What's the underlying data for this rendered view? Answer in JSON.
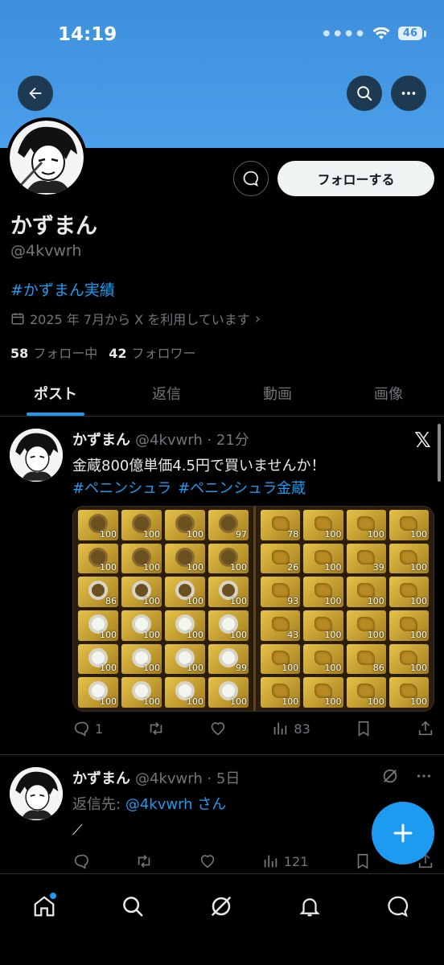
{
  "status_bar": {
    "time": "14:19",
    "battery": "46"
  },
  "profile": {
    "name": "かずまん",
    "handle": "@4kvwrh",
    "bio_hashtag": "#かずまん実績",
    "joined": "2025 年 7月から X を利用しています",
    "following_count": "58",
    "following_label": "フォロー中",
    "followers_count": "42",
    "followers_label": "フォロワー",
    "follow_button": "フォローする"
  },
  "tabs": [
    {
      "label": "ポスト",
      "active": true
    },
    {
      "label": "返信",
      "active": false
    },
    {
      "label": "動画",
      "active": false
    },
    {
      "label": "画像",
      "active": false
    }
  ],
  "posts": [
    {
      "name": "かずまん",
      "meta": "@4kvwrh · 21分",
      "text": "金蔵800億単価4.5円で買いませんか！",
      "tags": [
        "#ペニンシュラ",
        "#ペニンシュラ金蔵"
      ],
      "replies": "1",
      "views": "83",
      "media_left_quantities": [
        "100",
        "100",
        "100",
        "97",
        "100",
        "100",
        "100",
        "100",
        "86",
        "100",
        "100",
        "100",
        "100",
        "100",
        "100",
        "100",
        "100",
        "100",
        "100",
        "99",
        "100",
        "100",
        "100",
        "100"
      ],
      "media_right_quantities": [
        "78",
        "100",
        "100",
        "100",
        "26",
        "100",
        "39",
        "100",
        "93",
        "100",
        "100",
        "100",
        "43",
        "100",
        "100",
        "100",
        "100",
        "100",
        "86",
        "100",
        "100",
        "100",
        "100",
        "100"
      ]
    },
    {
      "name": "かずまん",
      "meta": "@4kvwrh · 5日",
      "reply_prefix": "返信先:",
      "reply_to": "@4kvwrh",
      "reply_suffix": "さん",
      "text": "⟋",
      "views": "121"
    }
  ],
  "colors": {
    "accent": "#1d9bf0",
    "banner": "#4ba0ea",
    "background": "#000000"
  }
}
